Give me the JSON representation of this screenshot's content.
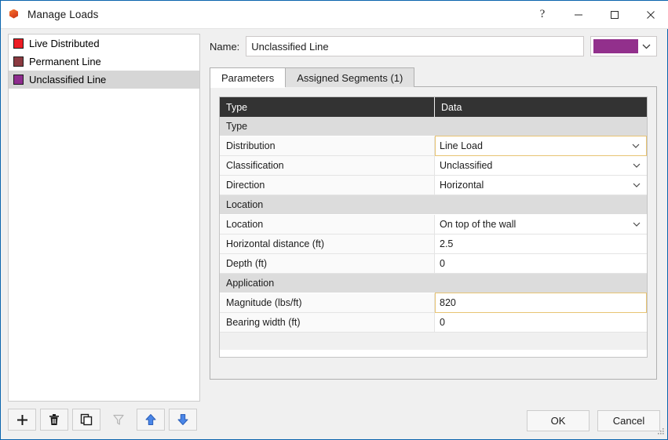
{
  "window": {
    "title": "Manage Loads",
    "icon": "app-cube-icon",
    "controls": {
      "help": "?",
      "minimize": "minimize-icon",
      "maximize": "maximize-icon",
      "close": "close-icon"
    }
  },
  "load_list": {
    "items": [
      {
        "label": "Live Distributed",
        "color": "#ED1C24",
        "selected": false
      },
      {
        "label": "Permanent Line",
        "color": "#8B3A41",
        "selected": false
      },
      {
        "label": "Unclassified Line",
        "color": "#8E2C8E",
        "selected": true
      }
    ]
  },
  "list_toolbar": {
    "buttons": [
      {
        "name": "add-load-button",
        "icon": "plus-icon",
        "enabled": true
      },
      {
        "name": "delete-load-button",
        "icon": "trash-icon",
        "enabled": true
      },
      {
        "name": "duplicate-load-button",
        "icon": "copy-icon",
        "enabled": true
      },
      {
        "name": "filter-loads-button",
        "icon": "funnel-icon",
        "enabled": false
      },
      {
        "name": "move-up-button",
        "icon": "arrow-up-icon",
        "enabled": true
      },
      {
        "name": "move-down-button",
        "icon": "arrow-down-icon",
        "enabled": true
      }
    ]
  },
  "name_row": {
    "label": "Name:",
    "value": "Unclassified Line",
    "placeholder": "",
    "color_value": "#92308C",
    "color_chevron": "chevron-down-icon"
  },
  "tabs": [
    {
      "label": "Parameters",
      "active": true
    },
    {
      "label": "Assigned Segments (1)",
      "active": false
    }
  ],
  "grid": {
    "headers": {
      "type": "Type",
      "data": "Data"
    },
    "rows": [
      {
        "kind": "group",
        "label": "Type"
      },
      {
        "kind": "prop",
        "label": "Distribution",
        "value": "Line Load",
        "control": "dropdown",
        "edited": true
      },
      {
        "kind": "prop",
        "label": "Classification",
        "value": "Unclassified",
        "control": "dropdown",
        "edited": false
      },
      {
        "kind": "prop",
        "label": "Direction",
        "value": "Horizontal",
        "control": "dropdown",
        "edited": false
      },
      {
        "kind": "group",
        "label": "Location"
      },
      {
        "kind": "prop",
        "label": "Location",
        "value": "On top of the wall",
        "control": "dropdown",
        "edited": false
      },
      {
        "kind": "prop",
        "label": "Horizontal distance (ft)",
        "value": "2.5",
        "control": "text",
        "edited": false
      },
      {
        "kind": "prop",
        "label": "Depth (ft)",
        "value": "0",
        "control": "text",
        "edited": false
      },
      {
        "kind": "group",
        "label": "Application"
      },
      {
        "kind": "prop",
        "label": "Magnitude (lbs/ft)",
        "value": "820",
        "control": "text",
        "edited": true
      },
      {
        "kind": "prop",
        "label": "Bearing width (ft)",
        "value": "0",
        "control": "text",
        "edited": false
      }
    ]
  },
  "footer": {
    "ok_label": "OK",
    "cancel_label": "Cancel"
  },
  "colors": {
    "accent_border": "#0a64ad",
    "header_bg": "#333333",
    "group_bg": "#dcdcdc",
    "edited_border": "#e8c473",
    "selection_bg": "#d6d6d6"
  }
}
